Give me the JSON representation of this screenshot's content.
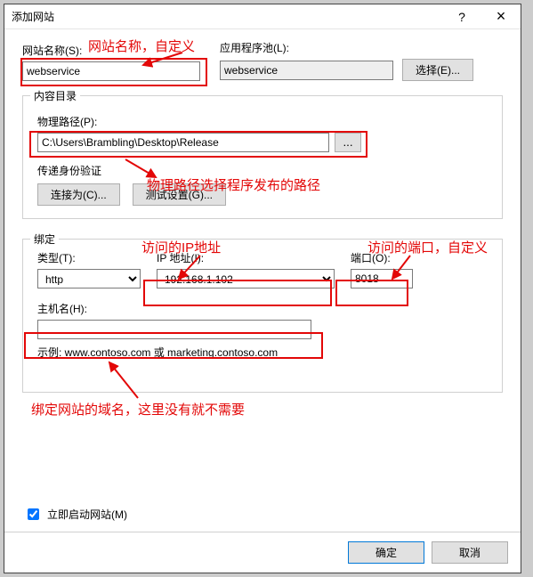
{
  "window": {
    "title": "添加网站",
    "help_glyph": "?",
    "close_glyph": "×"
  },
  "siteName": {
    "label": "网站名称(S):",
    "value": "webservice"
  },
  "appPool": {
    "label": "应用程序池(L):",
    "value": "webservice",
    "selectBtn": "选择(E)..."
  },
  "contentDir": {
    "legend": "内容目录",
    "pathLabel": "物理路径(P):",
    "pathValue": "C:\\Users\\Brambling\\Desktop\\Release",
    "browse": "...",
    "authLabel": "传递身份验证",
    "connectAs": "连接为(C)...",
    "testSettings": "测试设置(G)..."
  },
  "binding": {
    "legend": "绑定",
    "typeLabel": "类型(T):",
    "typeValue": "http",
    "ipLabel": "IP 地址(I):",
    "ipValue": "192.168.1.102",
    "portLabel": "端口(O):",
    "portValue": "8018",
    "hostLabel": "主机名(H):",
    "hostValue": "",
    "example": "示例: www.contoso.com 或 marketing.contoso.com"
  },
  "autostart": {
    "label": "立即启动网站(M)",
    "checked": true
  },
  "buttons": {
    "ok": "确定",
    "cancel": "取消"
  },
  "annotations": {
    "a1": "网站名称，自定义",
    "a2": "物理路径选择程序发布的路径",
    "a3": "访问的IP地址",
    "a4": "访问的端口，自定义",
    "a5": "绑定网站的域名，这里没有就不需要"
  }
}
